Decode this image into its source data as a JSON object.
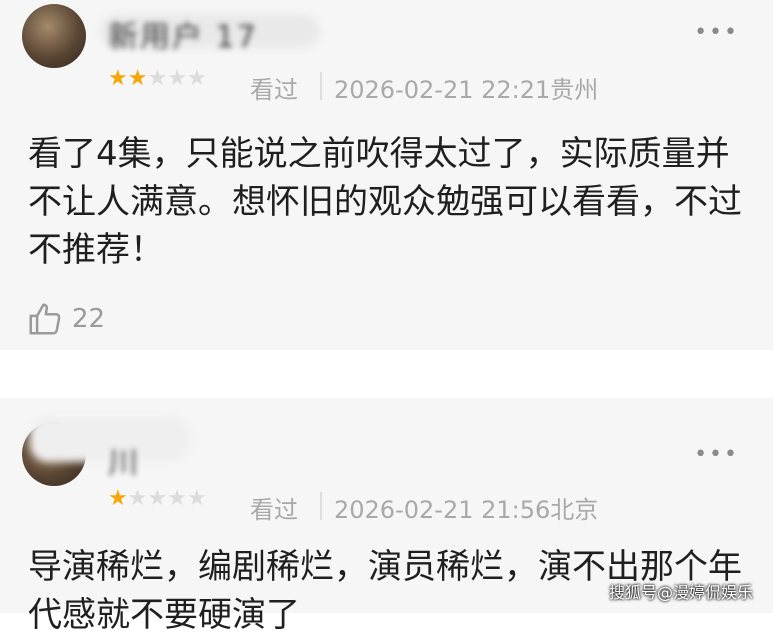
{
  "comments": [
    {
      "username": "新用户 17",
      "rating": 2,
      "max_rating": 5,
      "status": "看过",
      "date": "2026-02-21 22:21",
      "location": "贵州",
      "text": "看了4集，只能说之前吹得太过了，实际质量并不让人满意。想怀旧的观众勉强可以看看，不过不推荐！",
      "likes": "22",
      "more_icon": "more-dots-icon",
      "like_icon": "thumbs-up-icon"
    },
    {
      "username": "川",
      "rating": 1,
      "max_rating": 5,
      "status": "看过",
      "date": "2026-02-21 21:56",
      "location": "北京",
      "text": "导演稀烂，编剧稀烂，演员稀烂，演不出那个年代感就不要硬演了",
      "more_icon": "more-dots-icon"
    }
  ],
  "watermark": "搜狐号@漫婷侃娱乐",
  "colors": {
    "star_active": "#f5a70a",
    "star_inactive": "#dcdcdc",
    "meta_text": "#a9a9a9",
    "card_bg": "#f6f6f6"
  }
}
